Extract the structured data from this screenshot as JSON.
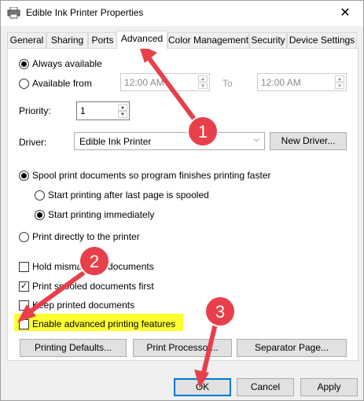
{
  "window": {
    "title": "Edible Ink Printer Properties",
    "close_glyph": "✕"
  },
  "tabs": [
    {
      "label": "General"
    },
    {
      "label": "Sharing"
    },
    {
      "label": "Ports"
    },
    {
      "label": "Advanced"
    },
    {
      "label": "Color Management"
    },
    {
      "label": "Security"
    },
    {
      "label": "Device Settings"
    }
  ],
  "availability": {
    "always_label": "Always available",
    "from_label": "Available from",
    "from_time": "12:00 AM",
    "to_label": "To",
    "to_time": "12:00 AM"
  },
  "priority": {
    "label": "Priority:",
    "value": "1"
  },
  "driver": {
    "label": "Driver:",
    "value": "Edible Ink Printer",
    "new_driver_label": "New Driver..."
  },
  "spool": {
    "spool_label": "Spool print documents so program finishes printing faster",
    "after_last_label": "Start printing after last page is spooled",
    "immediately_label": "Start printing immediately",
    "direct_label": "Print directly to the printer"
  },
  "options": {
    "hold_mismatched": "Hold mismatched documents",
    "print_spooled_first": "Print spooled documents first",
    "keep_printed": "Keep printed documents",
    "enable_advanced": "Enable advanced printing features"
  },
  "buttons": {
    "printing_defaults": "Printing Defaults...",
    "print_processor": "Print Processor...",
    "separator_page": "Separator Page...",
    "ok": "OK",
    "cancel": "Cancel",
    "apply": "Apply"
  },
  "annotations": [
    {
      "number": "1"
    },
    {
      "number": "2"
    },
    {
      "number": "3"
    }
  ],
  "colors": {
    "annotation_red": "#e8404a",
    "highlight_yellow": "#ffff30",
    "default_button_border": "#0078d7"
  },
  "icons": {
    "title_icon": "printer-icon",
    "close_icon": "close-icon",
    "dropdown_icon": "chevron-down-icon",
    "spin_up_icon": "spin-up-icon",
    "spin_down_icon": "spin-down-icon"
  }
}
